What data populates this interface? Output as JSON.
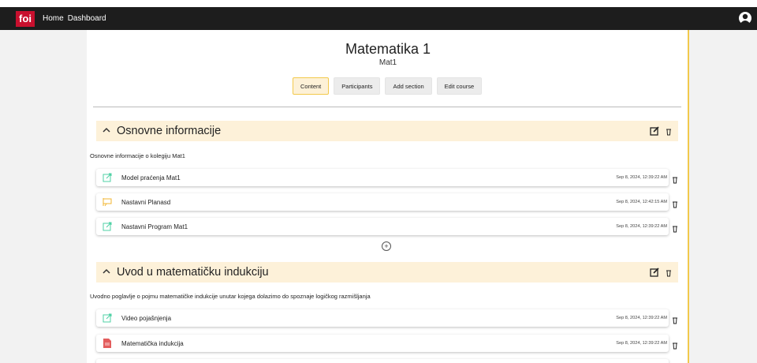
{
  "topbar": {
    "logo": "foi",
    "nav": [
      "Home",
      "Dashboard"
    ]
  },
  "course": {
    "title": "Matematika 1",
    "code": "Mat1",
    "tabs": [
      "Content",
      "Participants",
      "Add section",
      "Edit course"
    ]
  },
  "sections": [
    {
      "title": "Osnovne informacije",
      "description": "Osnovne informacije o kolegiju Mat1",
      "items": [
        {
          "label": "Model praćenja Mat1",
          "date": "Sep 8, 2024, 12:39:22 AM",
          "icon": "link-icon"
        },
        {
          "label": "Nastavni Planasd",
          "date": "Sep 8, 2024, 12:42:15 AM",
          "icon": "presentation-icon"
        },
        {
          "label": "Nastavni Program Mat1",
          "date": "Sep 8, 2024, 12:39:22 AM",
          "icon": "link-icon"
        }
      ]
    },
    {
      "title": "Uvod u matematičku indukciju",
      "description": "Uvodno poglavlje o pojmu matematičke indukcije unutar kojega dolazimo do spoznaje logičkog razmišljanja",
      "items": [
        {
          "label": "Video pojašnjenja",
          "date": "Sep 8, 2024, 12:39:22 AM",
          "icon": "link-icon"
        },
        {
          "label": "Matematička indukcija",
          "date": "Sep 8, 2024, 12:39:22 AM",
          "icon": "pdf-icon"
        }
      ]
    }
  ],
  "colors": {
    "accent": "#f2c94c",
    "section_bg": "#fdf1d9",
    "brand": "#c8102e",
    "link_icon": "#4fd1a5",
    "pdf_icon": "#e35d5d"
  }
}
